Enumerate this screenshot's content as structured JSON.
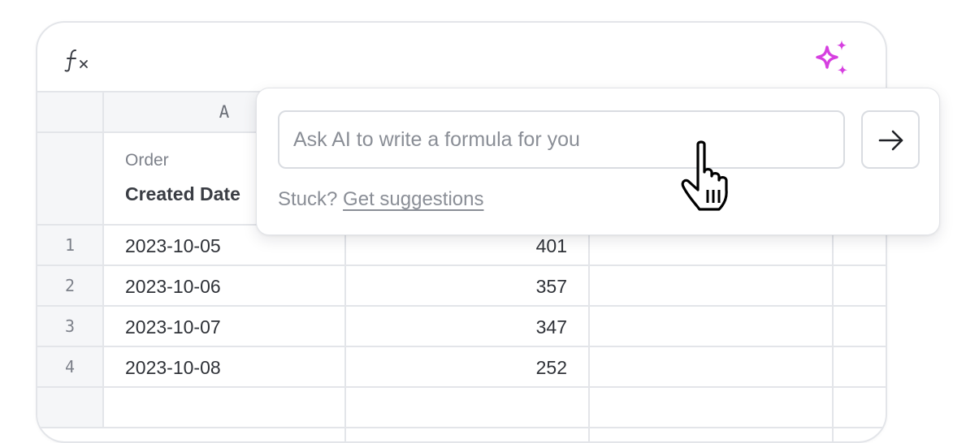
{
  "formula_bar": {
    "fx_icon": "function-fx-icon",
    "ai_icon": "sparkle-icon",
    "ai_icon_color": "#d63fe0"
  },
  "columns": [
    {
      "header": "A"
    }
  ],
  "title_row": {
    "subtitle": "Order",
    "title": "Created Date"
  },
  "rows": [
    {
      "num": "1",
      "date": "2023-10-05",
      "value": "401"
    },
    {
      "num": "2",
      "date": "2023-10-06",
      "value": "357"
    },
    {
      "num": "3",
      "date": "2023-10-07",
      "value": "347"
    },
    {
      "num": "4",
      "date": "2023-10-08",
      "value": "252"
    }
  ],
  "ai_popover": {
    "input_placeholder": "Ask AI to write a formula for you",
    "input_value": "",
    "submit_icon": "arrow-right-icon",
    "stuck_prefix": "Stuck?",
    "suggestions_link": "Get suggestions"
  },
  "cursor": "pointer-hand-icon"
}
